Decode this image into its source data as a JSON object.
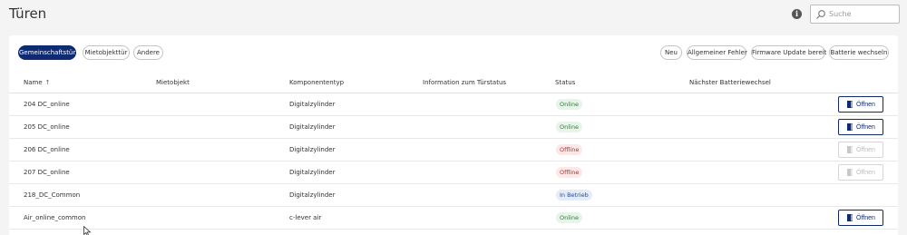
{
  "header": {
    "title": "Türen",
    "info_icon": "info-icon",
    "search": {
      "placeholder": "Suche",
      "value": ""
    }
  },
  "filters_left": [
    {
      "label": "Gemeinschaftstür",
      "active": true
    },
    {
      "label": "Mietobjekttür",
      "active": false
    },
    {
      "label": "Andere",
      "active": false
    }
  ],
  "filters_right": [
    {
      "label": "Neu"
    },
    {
      "label": "Allgemeiner Fehler"
    },
    {
      "label": "Firmware Update bereit"
    },
    {
      "label": "Batterie wechseln"
    }
  ],
  "table": {
    "columns": [
      "Name",
      "Mietobjekt",
      "Komponententyp",
      "Information zum Türstatus",
      "Status",
      "Nächster Batteriewechsel"
    ],
    "sort": {
      "column": "Name",
      "direction": "ascending"
    },
    "open_label": "Öffnen",
    "rows": [
      {
        "name": "204 DC_online",
        "mietobjekt": "",
        "komponententyp": "Digitalzylinder",
        "info": "",
        "status": "Online",
        "status_kind": "online",
        "batterie": "",
        "open": "enabled"
      },
      {
        "name": "205 DC_online",
        "mietobjekt": "",
        "komponententyp": "Digitalzylinder",
        "info": "",
        "status": "Online",
        "status_kind": "online",
        "batterie": "",
        "open": "enabled"
      },
      {
        "name": "206 DC_online",
        "mietobjekt": "",
        "komponententyp": "Digitalzylinder",
        "info": "",
        "status": "Offline",
        "status_kind": "offline",
        "batterie": "",
        "open": "disabled"
      },
      {
        "name": "207 DC_online",
        "mietobjekt": "",
        "komponententyp": "Digitalzylinder",
        "info": "",
        "status": "Offline",
        "status_kind": "offline",
        "batterie": "",
        "open": "disabled"
      },
      {
        "name": "218_DC_Common",
        "mietobjekt": "",
        "komponententyp": "Digitalzylinder",
        "info": "",
        "status": "In Betrieb",
        "status_kind": "betrieb",
        "batterie": "",
        "open": "none"
      },
      {
        "name": "Air_online_common",
        "mietobjekt": "",
        "komponententyp": "c-lever air",
        "info": "",
        "status": "Online",
        "status_kind": "online",
        "batterie": "",
        "open": "enabled"
      }
    ]
  },
  "colors": {
    "accent": "#0d2a73",
    "online_bg": "#e6f4ea",
    "online_text": "#2e7d32",
    "offline_bg": "#fde8e8",
    "offline_text": "#c62828"
  }
}
